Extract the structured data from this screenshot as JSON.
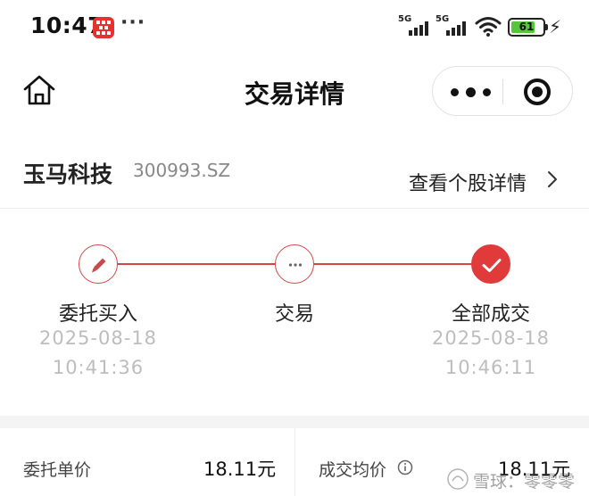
{
  "status_bar": {
    "time": "10:47",
    "more": "···",
    "signal_1_tag": "5G",
    "signal_2_tag": "5G",
    "battery": "61",
    "charging_icon": "bolt-icon",
    "app_icon_color": "#e8302e"
  },
  "nav": {
    "title": "交易详情",
    "home_icon": "home-icon",
    "more_icon": "more-icon",
    "close_icon": "target-close-icon"
  },
  "stock": {
    "name": "玉马科技",
    "code": "300993.SZ",
    "detail_link": "查看个股详情"
  },
  "progress": {
    "line_color": "#d24545",
    "steps": [
      {
        "label": "委托买入",
        "date": "2025-08-18",
        "time": "10:41:36",
        "icon": "pencil-icon",
        "state": "done"
      },
      {
        "label": "交易",
        "date": "",
        "time": "",
        "icon": "ellipsis-icon",
        "state": "pending"
      },
      {
        "label": "全部成交",
        "date": "2025-08-18",
        "time": "10:46:11",
        "icon": "check-icon",
        "state": "complete"
      }
    ]
  },
  "info": {
    "left_label": "委托单价",
    "left_value": "18.11元",
    "right_label": "成交均价",
    "right_value": "18.11元",
    "info_icon": "info-icon"
  },
  "watermark": {
    "text": "雪球：零零零"
  }
}
